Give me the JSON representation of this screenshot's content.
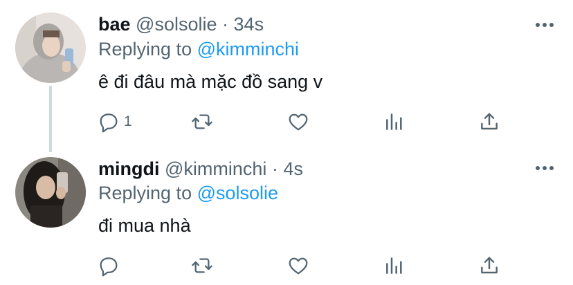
{
  "tweets": [
    {
      "display_name": "bae",
      "handle": "@solsolie",
      "separator": "·",
      "time": "34s",
      "replying_prefix": "Replying to",
      "replying_to": "@kimminchi",
      "text": "ê đi đâu mà mặc đồ sang v",
      "reply_count": "1",
      "actions": [
        "reply-icon",
        "retweet-icon",
        "like-icon",
        "analytics-icon",
        "share-icon"
      ]
    },
    {
      "display_name": "mingdi",
      "handle": "@kimminchi",
      "separator": "·",
      "time": "4s",
      "replying_prefix": "Replying to",
      "replying_to": "@solsolie",
      "text": "đi mua nhà",
      "reply_count": "",
      "actions": [
        "reply-icon",
        "retweet-icon",
        "like-icon",
        "analytics-icon",
        "share-icon"
      ]
    }
  ],
  "colors": {
    "text_primary": "#0f1419",
    "text_secondary": "#536471",
    "accent": "#1d9bf0",
    "thread_line": "#cfd9de"
  }
}
